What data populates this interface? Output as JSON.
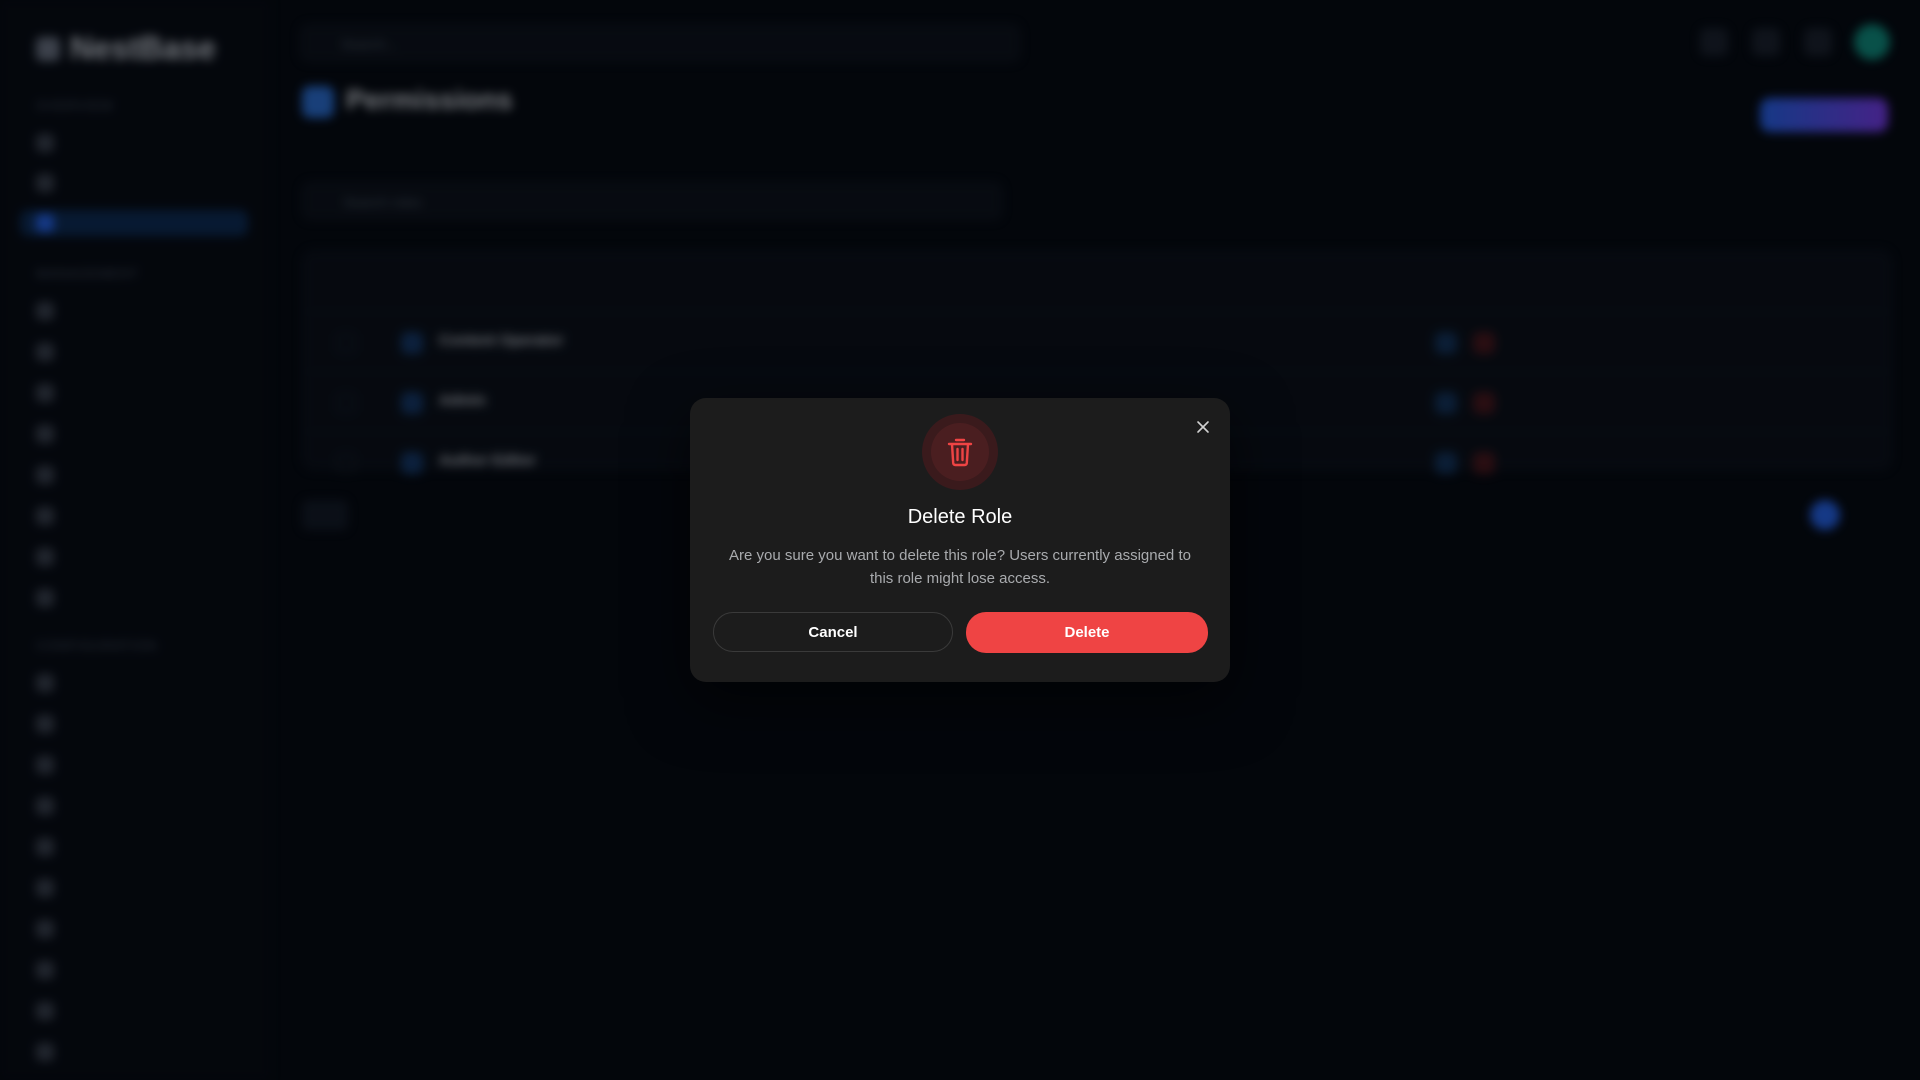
{
  "background": {
    "brand": "NestBase",
    "nav_sections": [
      "Overview",
      "Management",
      "Configuration"
    ],
    "search_placeholder": "Search...",
    "page_title": "Permissions",
    "page_subtitle": "",
    "primary_action": "",
    "filter_placeholder": "Search roles",
    "table_rows": [
      "Content Operator",
      "Admin",
      "Author Editor"
    ]
  },
  "modal": {
    "title": "Delete Role",
    "message": "Are you sure you want to delete this role? Users currently assigned to this role might lose access.",
    "cancel_label": "Cancel",
    "delete_label": "Delete",
    "close_icon": "close-icon",
    "header_icon": "trash-icon"
  },
  "colors": {
    "danger": "#ef4444",
    "modal_bg": "#1c1c1c",
    "page_bg": "#03060b",
    "accent": "#2563eb"
  }
}
